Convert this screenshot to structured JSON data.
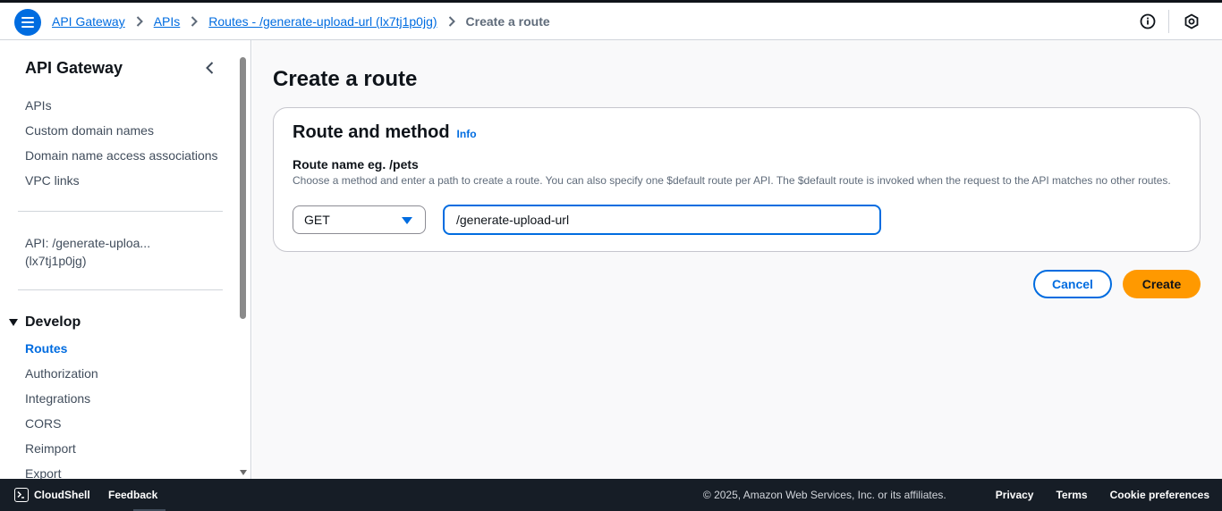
{
  "breadcrumbs": {
    "items": [
      "API Gateway",
      "APIs",
      "Routes - /generate-upload-url (lx7tj1p0jg)"
    ],
    "current": "Create a route"
  },
  "header_icons": [
    "info-icon",
    "notifications-icon"
  ],
  "sidebar": {
    "title": "API Gateway",
    "links": [
      "APIs",
      "Custom domain names",
      "Domain name access associations",
      "VPC links"
    ],
    "api_label": "API: /generate-uploa... (lx7tj1p0jg)",
    "section": "Develop",
    "develop_items": [
      "Routes",
      "Authorization",
      "Integrations",
      "CORS",
      "Reimport",
      "Export"
    ],
    "active_item": "Routes"
  },
  "main": {
    "page_title": "Create a route",
    "panel": {
      "title": "Route and method",
      "info_link": "Info",
      "field_label": "Route name eg. /pets",
      "field_description": "Choose a method and enter a path to create a route. You can also specify one $default route per API. The $default route is invoked when the request to the API matches no other routes.",
      "method_value": "GET",
      "path_value": "/generate-upload-url"
    },
    "buttons": {
      "cancel": "Cancel",
      "create": "Create"
    }
  },
  "footer": {
    "cloudshell": "CloudShell",
    "feedback": "Feedback",
    "copyright": "© 2025, Amazon Web Services, Inc. or its affiliates.",
    "links": [
      "Privacy",
      "Terms",
      "Cookie preferences"
    ]
  },
  "colors": {
    "accent": "#006ce0",
    "primary_button": "#ff9900",
    "footer_bg": "#161d26"
  }
}
